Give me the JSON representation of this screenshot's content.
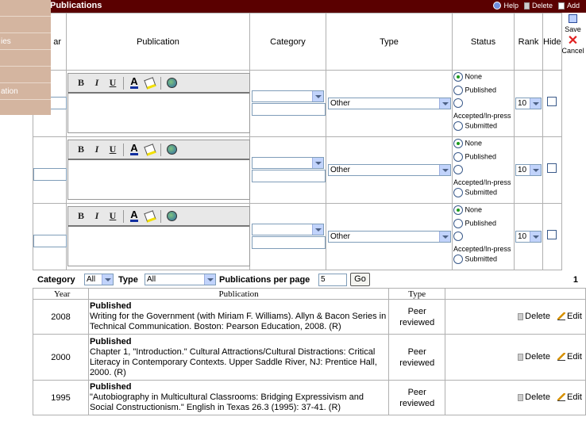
{
  "header": {
    "title": "Publications",
    "help": "Help",
    "delete": "Delete",
    "add": "Add"
  },
  "menu": {
    "items": [
      "",
      "",
      "ies",
      "",
      "",
      "ation"
    ]
  },
  "columns": {
    "year": "ar",
    "publication": "Publication",
    "category": "Category",
    "type": "Type",
    "status": "Status",
    "rank": "Rank",
    "hide": "Hide"
  },
  "side_actions": {
    "save": "Save",
    "cancel": "Cancel"
  },
  "edit_rows": [
    {
      "type_value": "Other",
      "rank_value": "10",
      "status_options": [
        "None",
        "Published",
        "Accepted/In-press",
        "Submitted"
      ],
      "status_selected": "None"
    },
    {
      "type_value": "Other",
      "rank_value": "10",
      "status_options": [
        "None",
        "Published",
        "Accepted/In-press",
        "Submitted"
      ],
      "status_selected": "None"
    },
    {
      "type_value": "Other",
      "rank_value": "10",
      "status_options": [
        "None",
        "Published",
        "Accepted/In-press",
        "Submitted"
      ],
      "status_selected": "None"
    }
  ],
  "editor_toolbar": {
    "bold": "B",
    "italic": "I",
    "underline": "U",
    "font_color": "A"
  },
  "filter": {
    "category_label": "Category",
    "category_value": "All",
    "type_label": "Type",
    "type_value": "All",
    "per_page_label": "Publications per page",
    "per_page_value": "5",
    "go": "Go",
    "page": "1"
  },
  "list": {
    "headers": {
      "year": "Year",
      "publication": "Publication",
      "type": "Type"
    },
    "rows": [
      {
        "year": "2008",
        "status": "Published",
        "citation": "Writing for the Government (with Miriam F. Williams). Allyn & Bacon Series in Technical Communication. Boston: Pearson Education, 2008. (R)",
        "type": "Peer reviewed",
        "delete": "Delete",
        "edit": "Edit"
      },
      {
        "year": "2000",
        "status": "Published",
        "citation": "Chapter 1, \"Introduction.\" Cultural Attractions/Cultural Distractions: Critical Literacy in Contemporary Contexts. Upper Saddle River, NJ: Prentice Hall, 2000. (R)",
        "type": "Peer reviewed",
        "delete": "Delete",
        "edit": "Edit"
      },
      {
        "year": "1995",
        "status": "Published",
        "citation": "\"Autobiography in Multicultural  Classrooms: Bridging Expressivism and Social Constructionism.\" English in Texas 26.3 (1995): 37-41. (R)",
        "type": "Peer reviewed",
        "delete": "Delete",
        "edit": "Edit"
      }
    ]
  }
}
